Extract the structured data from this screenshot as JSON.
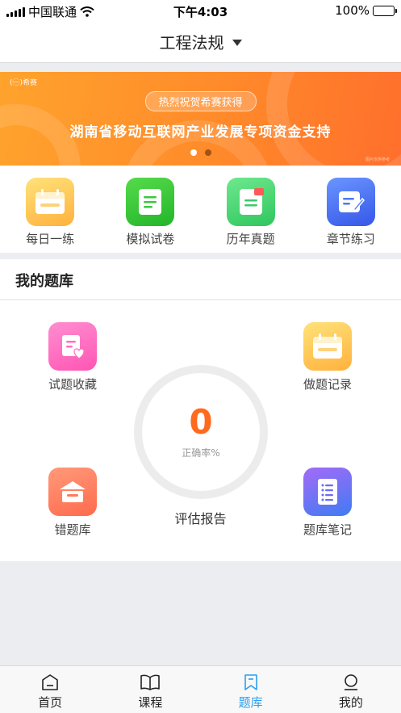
{
  "status_bar": {
    "carrier": "中国联通",
    "time": "下午4:03",
    "battery": "100%",
    "battery_color": "#36c93b"
  },
  "nav": {
    "title": "工程法规"
  },
  "banner": {
    "brand": "(㊀)希赛",
    "pill_text": "热烈祝贺希赛获得",
    "headline": "湖南省移动互联网产业发展专项资金支持",
    "fine_print": "图片仅供参考",
    "page_count": 2,
    "active_page": 1,
    "colors": {
      "start": "#ffa32d",
      "end": "#ff6f2c"
    }
  },
  "quick_actions": [
    {
      "label": "每日一练",
      "icon": "calendar-icon",
      "color": "#ffc34d"
    },
    {
      "label": "模拟试卷",
      "icon": "document-icon",
      "color": "#3bc83a"
    },
    {
      "label": "历年真题",
      "icon": "archive-document-icon",
      "color": "#4fd875"
    },
    {
      "label": "章节练习",
      "icon": "edit-note-icon",
      "color": "#4a79f5"
    }
  ],
  "my_library": {
    "title": "我的题库",
    "items": [
      {
        "label": "试题收藏",
        "icon": "favorite-questions-icon",
        "color": "#ff6fc3"
      },
      {
        "label": "做题记录",
        "icon": "calendar-record-icon",
        "color": "#ffc34d"
      },
      {
        "label": "错题库",
        "icon": "wrong-questions-icon",
        "color": "#ff7a5c"
      },
      {
        "label": "题库笔记",
        "icon": "notes-icon",
        "color": "#7b5cf5"
      }
    ],
    "accuracy_value": "0",
    "accuracy_label": "正确率%",
    "report_label": "评估报告",
    "accent_color": "#ff6a1f"
  },
  "tab_bar": {
    "active_color": "#2b9ef0",
    "tabs": [
      {
        "label": "首页",
        "icon": "home-icon",
        "active": false
      },
      {
        "label": "课程",
        "icon": "book-icon",
        "active": false
      },
      {
        "label": "题库",
        "icon": "bookmark-icon",
        "active": true
      },
      {
        "label": "我的",
        "icon": "profile-icon",
        "active": false
      }
    ]
  }
}
